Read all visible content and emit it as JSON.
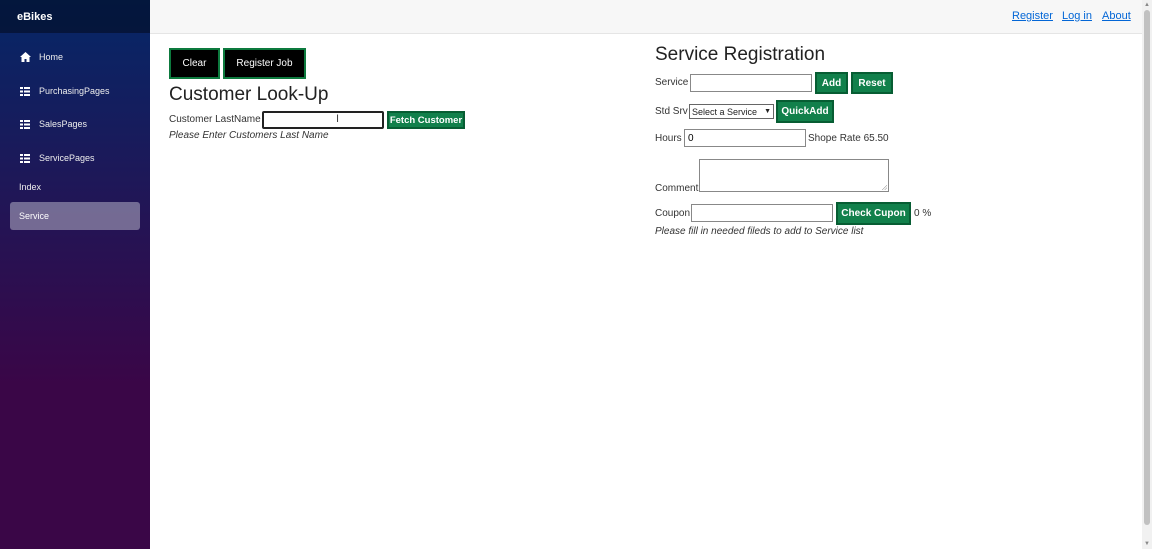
{
  "brand": "eBikes",
  "nav": {
    "home": "Home",
    "purchasing": "PurchasingPages",
    "sales": "SalesPages",
    "service_pages": "ServicePages",
    "index": "Index",
    "service": "Service"
  },
  "topbar": {
    "register": "Register",
    "login": "Log in",
    "about": "About"
  },
  "left": {
    "clear_label": "Clear",
    "register_job_label": "Register Job",
    "title": "Customer Look-Up",
    "lastname_label": "Customer LastName",
    "lastname_value": "",
    "fetch_label": "Fetch Customer",
    "hint": "Please Enter Customers Last Name"
  },
  "right": {
    "title": "Service Registration",
    "service_label": "Service",
    "service_value": "",
    "add_label": "Add",
    "reset_label": "Reset",
    "std_label": "Std Srv",
    "std_selected": "Select a Service",
    "quickadd_label": "QuickAdd",
    "hours_label": "Hours",
    "hours_value": "0",
    "shop_rate": "Shope Rate 65.50",
    "comment_label": "Comment",
    "coupon_label": "Coupon",
    "coupon_value": "",
    "check_label": "Check Cupon",
    "percent": "0 %",
    "hint": "Please fill in needed fileds to add to Service list"
  },
  "colors": {
    "accent_green": "#11804b",
    "sidebar_top": "#052767",
    "sidebar_bottom": "#3a0647",
    "link": "#0366d6"
  }
}
